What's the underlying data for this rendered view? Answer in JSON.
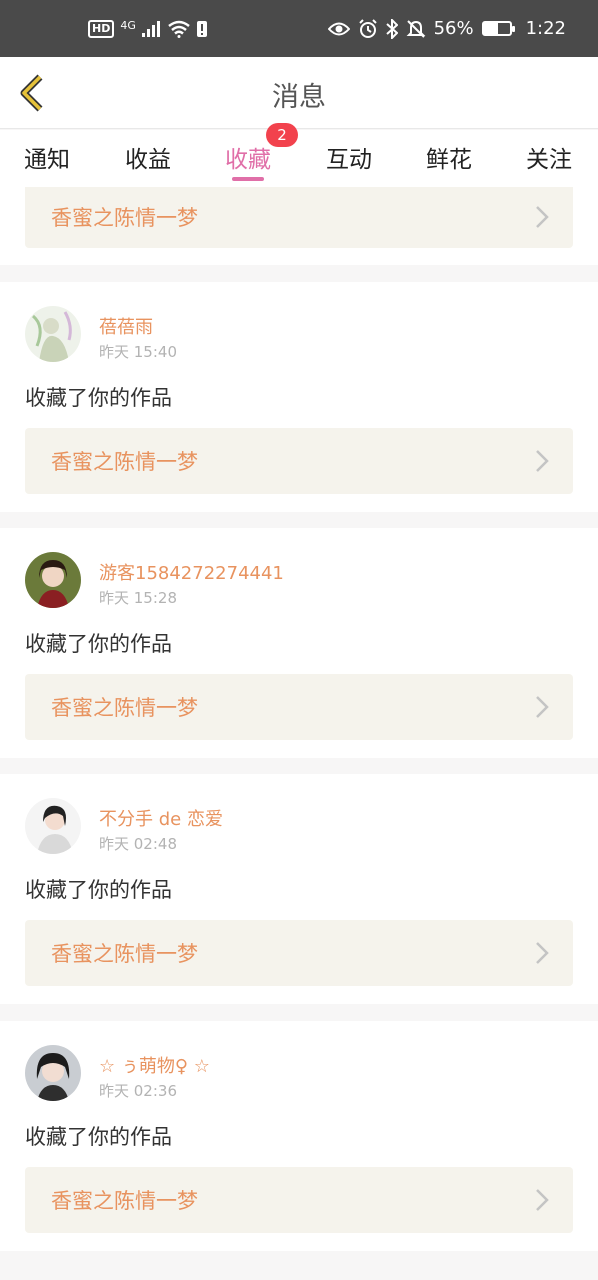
{
  "status_bar": {
    "left_badge": "HD",
    "network": "4G",
    "battery": "56%",
    "battery_level": 0.56,
    "time": "1:22"
  },
  "header": {
    "title": "消息"
  },
  "tabs": [
    {
      "label": "通知"
    },
    {
      "label": "收益"
    },
    {
      "label": "收藏",
      "active": true,
      "badge": "2"
    },
    {
      "label": "互动"
    },
    {
      "label": "鲜花"
    },
    {
      "label": "关注"
    }
  ],
  "partial_card": {
    "work_title": "香蜜之陈情一梦"
  },
  "items": [
    {
      "user": "蓓蓓雨",
      "time": "昨天 15:40",
      "action": "收藏了你的作品",
      "work_title": "香蜜之陈情一梦"
    },
    {
      "user": "游客1584272274441",
      "time": "昨天 15:28",
      "action": "收藏了你的作品",
      "work_title": "香蜜之陈情一梦"
    },
    {
      "user": "不分手 de 恋爱",
      "time": "昨天 02:48",
      "action": "收藏了你的作品",
      "work_title": "香蜜之陈情一梦"
    },
    {
      "user": "☆ ぅ萌物♀ ☆",
      "time": "昨天 02:36",
      "action": "收藏了你的作品",
      "work_title": "香蜜之陈情一梦"
    }
  ],
  "colors": {
    "accent": "#e06fa8",
    "username": "#e8935f",
    "badge": "#f2424d",
    "back_icon": "#e6c23a"
  }
}
